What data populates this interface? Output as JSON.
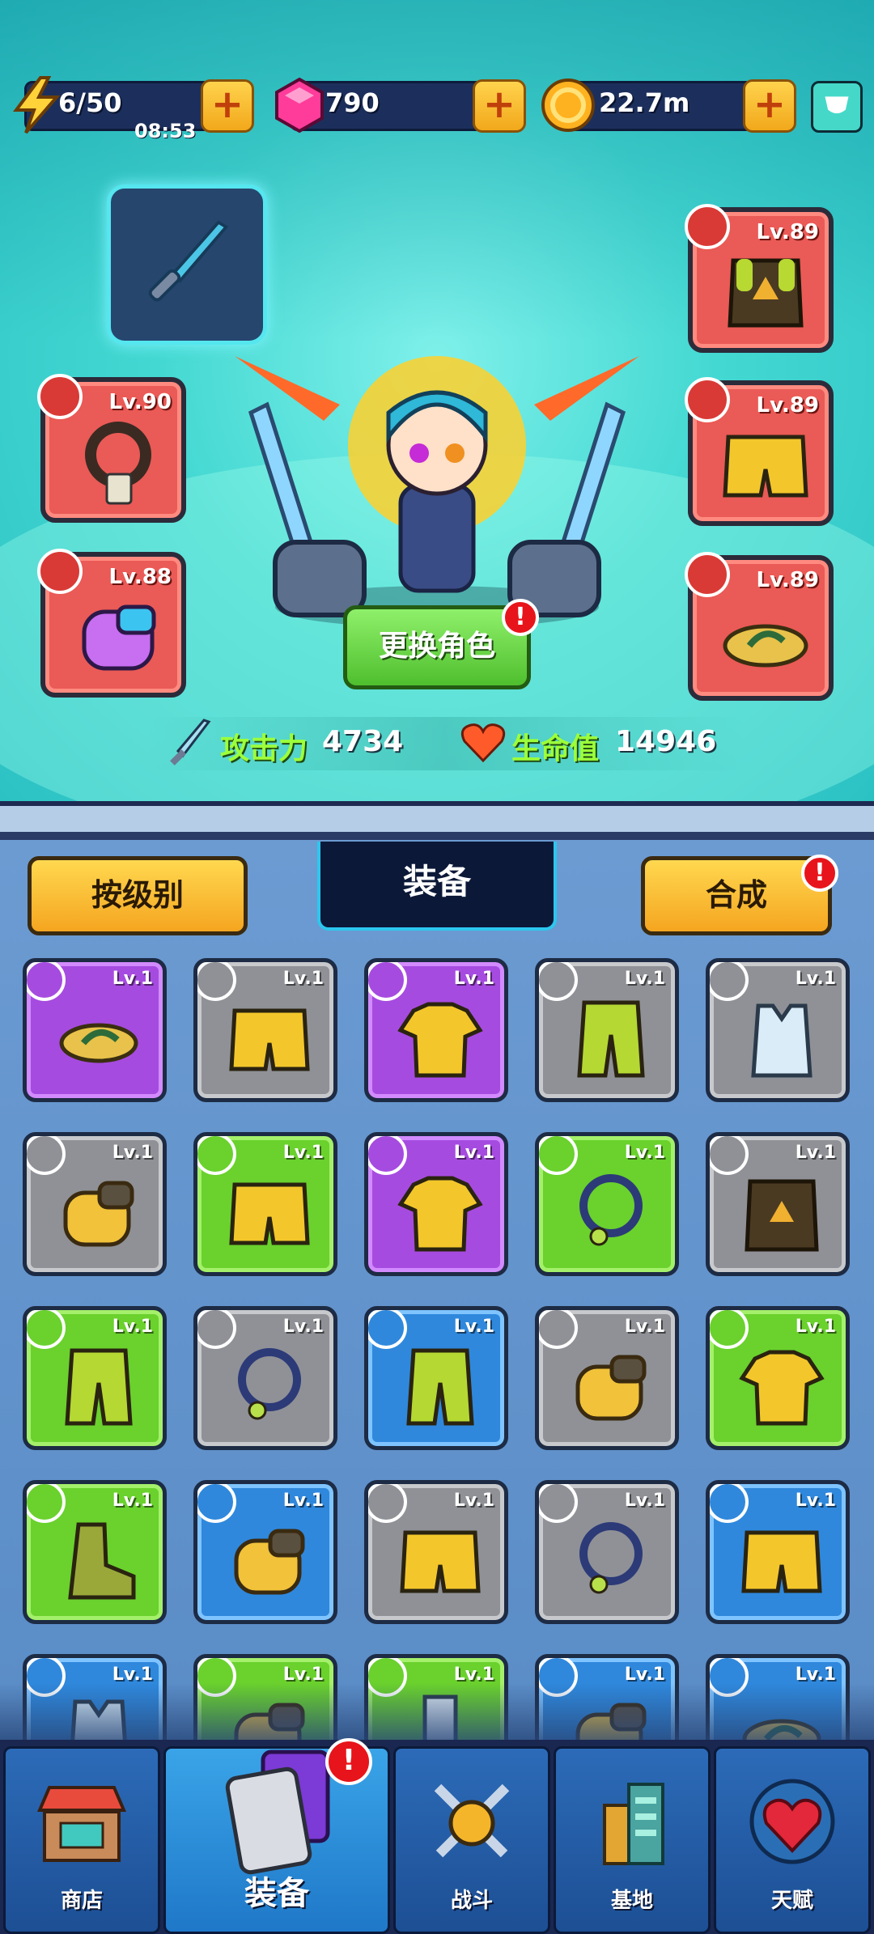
{
  "resources": {
    "energy": "6/50",
    "energy_timer": "08:53",
    "gems": "790",
    "coins": "22.7m",
    "plus": "+"
  },
  "equipped": {
    "necklace_lv": "Lv.90",
    "gloves_lv": "Lv.88",
    "armor_lv": "Lv.89",
    "shorts_lv": "Lv.89",
    "shoes_lv": "Lv.89"
  },
  "character": {
    "swap_label": "更换角色",
    "alert": "!"
  },
  "stats": {
    "attack_label": "攻击力",
    "attack_value": "4734",
    "hp_label": "生命值",
    "hp_value": "14946"
  },
  "inventory": {
    "sort_label": "按级别",
    "title": "装备",
    "merge_label": "合成",
    "merge_alert": "!",
    "items": [
      {
        "rarity": "purple",
        "type": "shoes",
        "lv": "Lv.1"
      },
      {
        "rarity": "gray",
        "type": "shorts",
        "lv": "Lv.1"
      },
      {
        "rarity": "purple",
        "type": "shirt",
        "lv": "Lv.1"
      },
      {
        "rarity": "gray",
        "type": "pants",
        "lv": "Lv.1"
      },
      {
        "rarity": "gray",
        "type": "vest",
        "lv": "Lv.1"
      },
      {
        "rarity": "gray",
        "type": "glove",
        "lv": "Lv.1"
      },
      {
        "rarity": "green",
        "type": "shorts",
        "lv": "Lv.1"
      },
      {
        "rarity": "purple",
        "type": "shirt",
        "lv": "Lv.1"
      },
      {
        "rarity": "green",
        "type": "necklace",
        "lv": "Lv.1"
      },
      {
        "rarity": "gray",
        "type": "armor",
        "lv": "Lv.1"
      },
      {
        "rarity": "green",
        "type": "pants",
        "lv": "Lv.1"
      },
      {
        "rarity": "gray",
        "type": "necklace",
        "lv": "Lv.1"
      },
      {
        "rarity": "blue",
        "type": "pants",
        "lv": "Lv.1"
      },
      {
        "rarity": "gray",
        "type": "glove",
        "lv": "Lv.1"
      },
      {
        "rarity": "green",
        "type": "shirt",
        "lv": "Lv.1"
      },
      {
        "rarity": "green",
        "type": "boots",
        "lv": "Lv.1"
      },
      {
        "rarity": "blue",
        "type": "glove",
        "lv": "Lv.1"
      },
      {
        "rarity": "gray",
        "type": "shorts",
        "lv": "Lv.1"
      },
      {
        "rarity": "gray",
        "type": "necklace",
        "lv": "Lv.1"
      },
      {
        "rarity": "blue",
        "type": "shorts",
        "lv": "Lv.1"
      },
      {
        "rarity": "blue",
        "type": "vest",
        "lv": "Lv.1"
      },
      {
        "rarity": "green",
        "type": "glove",
        "lv": "Lv.1"
      },
      {
        "rarity": "green",
        "type": "sock",
        "lv": "Lv.1"
      },
      {
        "rarity": "blue",
        "type": "glove",
        "lv": "Lv.1"
      },
      {
        "rarity": "blue",
        "type": "shoes",
        "lv": "Lv.1"
      }
    ]
  },
  "nav": {
    "shop": "商店",
    "equipment": "装备",
    "battle": "战斗",
    "base": "基地",
    "talent": "天赋",
    "alert": "!"
  },
  "colors": {
    "purple": "#a64be0",
    "gray": "#8f9196",
    "green": "#6ad12d",
    "blue": "#2f88dc",
    "equipped": "#ea5a56"
  }
}
